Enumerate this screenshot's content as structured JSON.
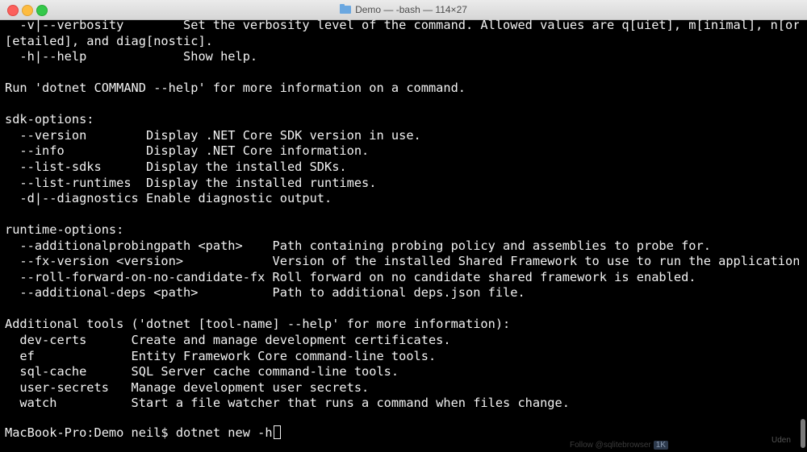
{
  "window": {
    "title": "Demo — -bash — 114×27",
    "controls": {
      "close": "close-light",
      "minimize": "minimize-light",
      "maximize": "zoom-light"
    }
  },
  "terminal": {
    "lines": [
      "  -v|--verbosity        Set the verbosity level of the command. Allowed values are q[uiet], m[inimal], n[ormal], d",
      "[etailed], and diag[nostic].",
      "  -h|--help             Show help.",
      "",
      "Run 'dotnet COMMAND --help' for more information on a command.",
      "",
      "sdk-options:",
      "  --version        Display .NET Core SDK version in use.",
      "  --info           Display .NET Core information.",
      "  --list-sdks      Display the installed SDKs.",
      "  --list-runtimes  Display the installed runtimes.",
      "  -d|--diagnostics Enable diagnostic output.",
      "",
      "runtime-options:",
      "  --additionalprobingpath <path>    Path containing probing policy and assemblies to probe for.",
      "  --fx-version <version>            Version of the installed Shared Framework to use to run the application.",
      "  --roll-forward-on-no-candidate-fx Roll forward on no candidate shared framework is enabled.",
      "  --additional-deps <path>          Path to additional deps.json file.",
      "",
      "Additional tools ('dotnet [tool-name] --help' for more information):",
      "  dev-certs      Create and manage development certificates.",
      "  ef             Entity Framework Core command-line tools.",
      "  sql-cache      SQL Server cache command-line tools.",
      "  user-secrets   Manage development user secrets.",
      "  watch          Start a file watcher that runs a command when files change.",
      ""
    ],
    "prompt": "MacBook-Pro:Demo neil$ ",
    "command": "dotnet new -h"
  },
  "overlay": {
    "follow_text": "Follow @sqlitebrowser",
    "follow_count": "1K",
    "watermark": "Uden"
  },
  "colors": {
    "background": "#000000",
    "text": "#f2f2f2"
  }
}
